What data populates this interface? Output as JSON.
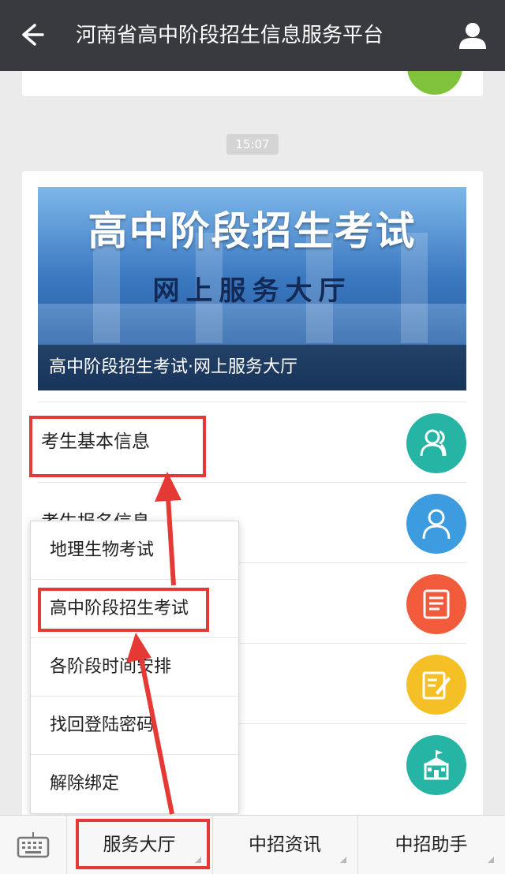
{
  "header": {
    "title": "河南省高中阶段招生信息服务平台"
  },
  "chat": {
    "timestamp": "15:07"
  },
  "banner": {
    "title": "高中阶段招生考试",
    "subtitle": "网上服务大厅",
    "caption": "高中阶段招生考试·网上服务大厅"
  },
  "menu_rows": [
    {
      "label": "考生基本信息",
      "icon": "users-icon",
      "color": "#26b5a5"
    },
    {
      "label": "考生报名信息",
      "icon": "user-icon",
      "color": "#3d9be0"
    },
    {
      "label": "",
      "icon": "document-icon",
      "color": "#f15a3a"
    },
    {
      "label": "",
      "icon": "edit-icon",
      "color": "#f5c026"
    },
    {
      "label": "",
      "icon": "school-icon",
      "color": "#26b5a5"
    }
  ],
  "popup_menu": {
    "items": [
      "地理生物考试",
      "高中阶段招生考试",
      "各阶段时间安排",
      "找回登陆密码",
      "解除绑定"
    ]
  },
  "bottom_tabs": [
    "服务大厅",
    "中招资讯",
    "中招助手"
  ],
  "colors": {
    "topbar": "#393a3f",
    "highlight": "#e53935"
  }
}
